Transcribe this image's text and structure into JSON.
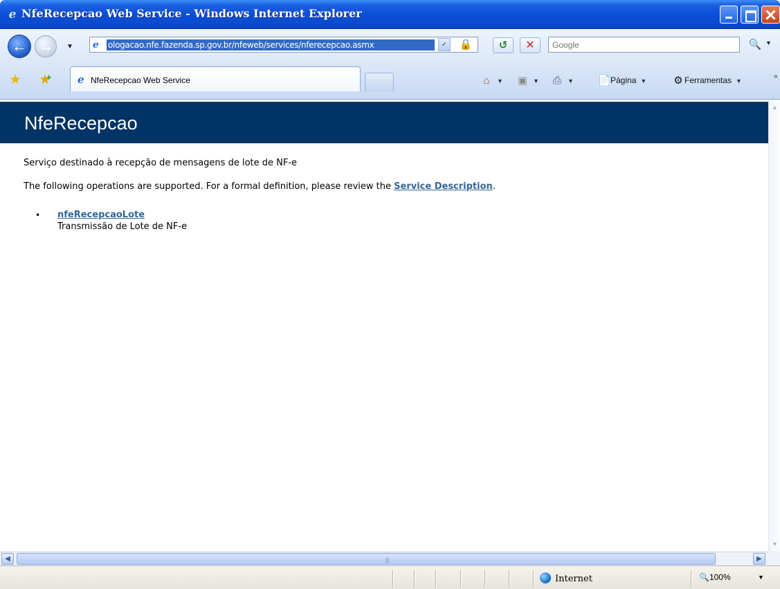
{
  "window": {
    "title": "NfeRecepcao Web Service - Windows Internet Explorer"
  },
  "address_bar": {
    "url": "ologacao.nfe.fazenda.sp.gov.br/nfeweb/services/nferecepcao.asmx"
  },
  "search_bar": {
    "placeholder": "Google"
  },
  "tab": {
    "label": "NfeRecepcao Web Service"
  },
  "command_bar": {
    "page_label": "Página",
    "tools_label": "Ferramentas"
  },
  "page": {
    "heading": "NfeRecepcao",
    "description": "Serviço destinado à recepção de mensagens de lote de NF-e",
    "operations_intro": "The following operations are supported. For a formal definition, please review the ",
    "service_description_link": "Service Description",
    "operations_intro_end": ".",
    "operations": [
      {
        "name": "nfeRecepcaoLote",
        "description": "Transmissão de Lote de NF-e"
      }
    ]
  },
  "status_bar": {
    "zone": "Internet",
    "zoom": "100%"
  },
  "icons": {
    "back": "back-arrow-icon",
    "forward": "forward-arrow-icon",
    "refresh": "refresh-icon",
    "stop": "stop-icon",
    "home": "home-icon",
    "feeds": "feeds-icon",
    "print": "print-icon",
    "page": "page-icon",
    "tools": "gear-icon",
    "favorites": "star-icon",
    "add_favorite": "add-favorite-icon",
    "lock": "lock-icon",
    "search": "search-icon",
    "internet_zone": "globe-icon",
    "zoom": "zoom-icon"
  },
  "colors": {
    "banner": "#003366",
    "link": "#336699",
    "titlebar": "#0a4fd8"
  }
}
